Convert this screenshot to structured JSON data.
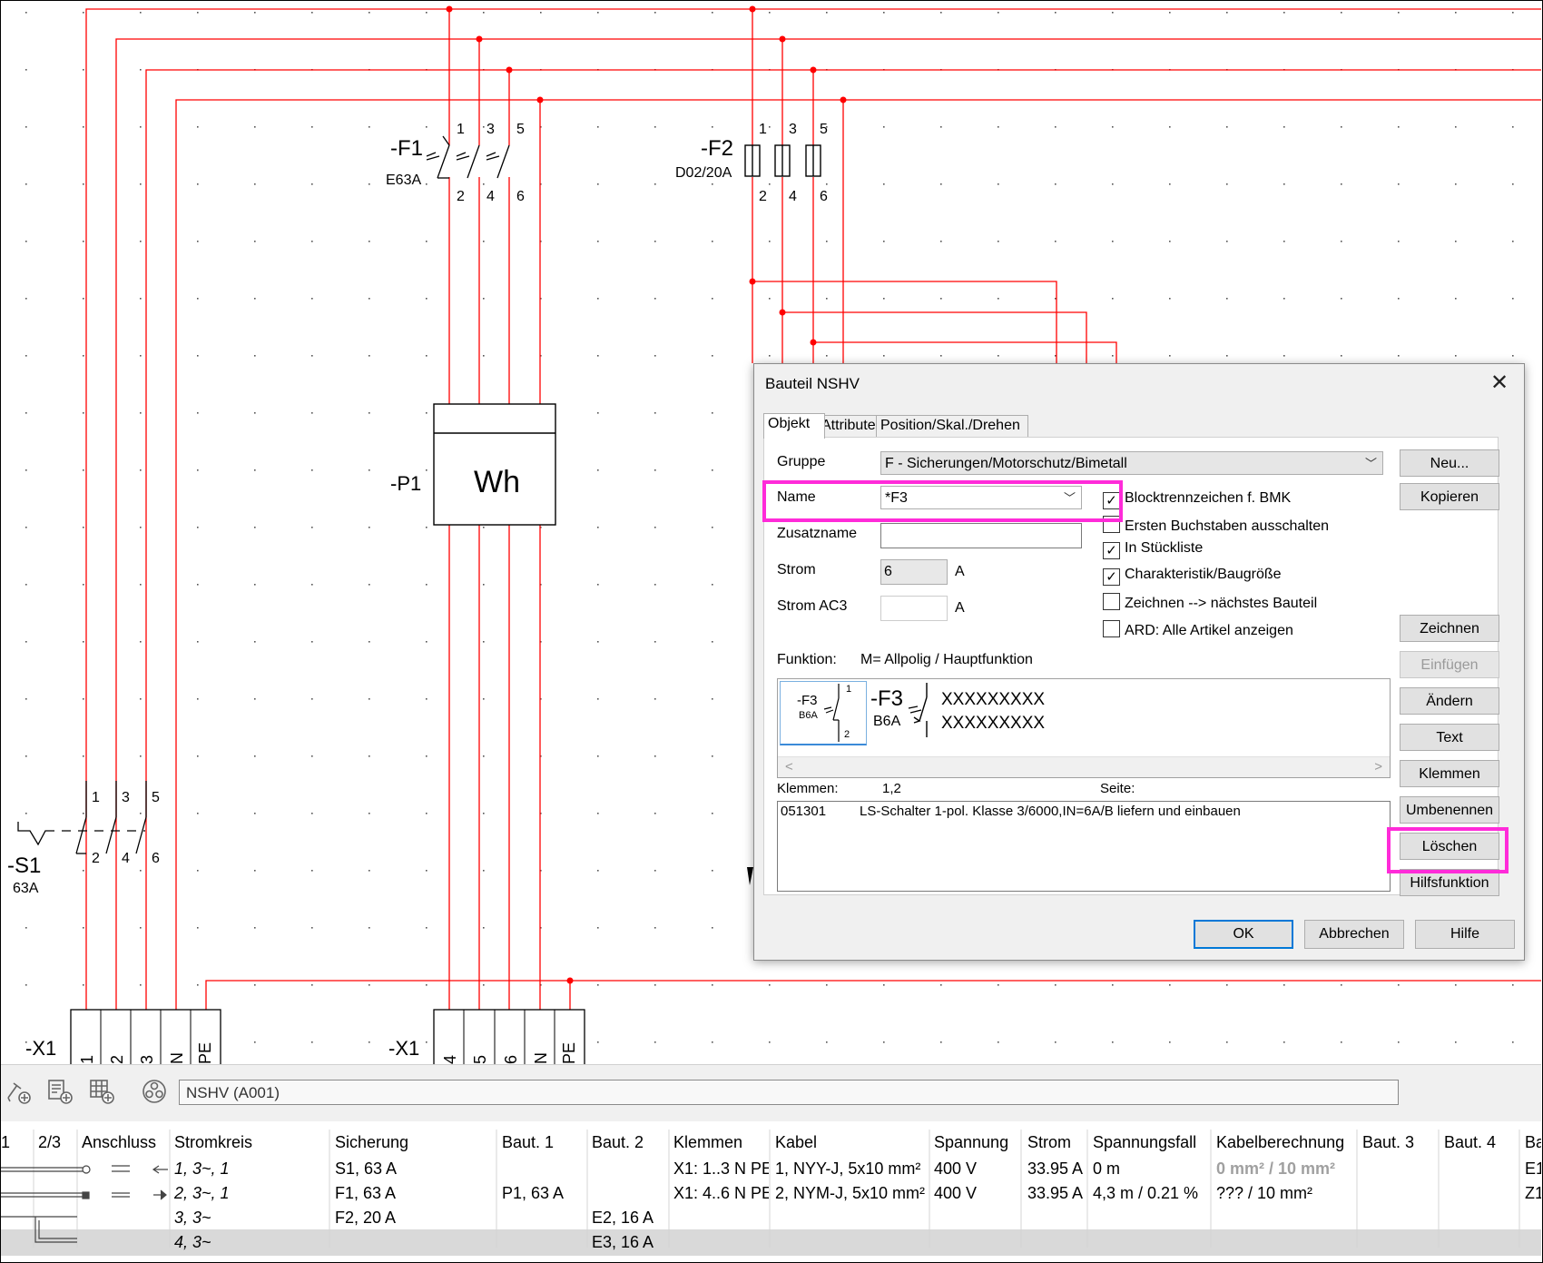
{
  "schematic": {
    "f1": {
      "name": "-F1",
      "rating": "E63A",
      "top_terminals": [
        "1",
        "3",
        "5"
      ],
      "bottom_terminals": [
        "2",
        "4",
        "6"
      ]
    },
    "f2": {
      "name": "-F2",
      "rating": "D02/20A",
      "top_terminals": [
        "1",
        "3",
        "5"
      ],
      "bottom_terminals": [
        "2",
        "4",
        "6"
      ]
    },
    "p1": {
      "name": "-P1",
      "meter_label": "Wh"
    },
    "s1": {
      "name": "-S1",
      "rating": "63A",
      "top_terminals": [
        "1",
        "3",
        "5"
      ],
      "bottom_terminals": [
        "2",
        "4",
        "6"
      ]
    },
    "x1_left": {
      "name": "-X1",
      "terminals": [
        "1",
        "2",
        "3",
        "N",
        "PE"
      ]
    },
    "x1_right": {
      "name": "-X1",
      "terminals": [
        "4",
        "5",
        "6",
        "N",
        "PE"
      ]
    },
    "wire_color": "#ff0000"
  },
  "dialog": {
    "title": "Bauteil NSHV",
    "close_icon": "close-icon",
    "tabs": [
      "Objekt",
      "Attribute",
      "Position/Skal./Drehen"
    ],
    "active_tab": "Objekt",
    "gruppe_label": "Gruppe",
    "gruppe_value": "F - Sicherungen/Motorschutz/Bimetall",
    "name_label": "Name",
    "name_value": "*F3",
    "zusatzname_label": "Zusatzname",
    "zusatzname_value": "",
    "strom_label": "Strom",
    "strom_value": "6",
    "strom_unit": "A",
    "strom_ac3_label": "Strom AC3",
    "strom_ac3_value": "",
    "strom_ac3_unit": "A",
    "checkboxes": [
      {
        "label": "Blocktrennzeichen f. BMK",
        "checked": true
      },
      {
        "label": "Ersten Buchstaben ausschalten",
        "checked": false
      },
      {
        "label": "In Stückliste",
        "checked": true
      },
      {
        "label": "Charakteristik/Baugröße",
        "checked": true
      },
      {
        "label": "Zeichnen --> nächstes Bauteil",
        "checked": false
      },
      {
        "label": "ARD: Alle Artikel anzeigen",
        "checked": false
      }
    ],
    "funktion_label": "Funktion:",
    "funktion_value": "M= Allpolig / Hauptfunktion",
    "preview": {
      "small_name": "-F3",
      "small_rating": "B6A",
      "small_t1": "1",
      "small_t2": "2",
      "big_name": "-F3",
      "big_rating": "B6A",
      "text1": "XXXXXXXXX",
      "text2": "XXXXXXXXX"
    },
    "klemmen_label": "Klemmen:",
    "klemmen_value": "1,2",
    "seite_label": "Seite:",
    "articles": [
      {
        "number": "051301",
        "description": "LS-Schalter 1-pol. Klasse 3/6000,IN=6A/B liefern und einbauen"
      }
    ],
    "buttons": {
      "neu": "Neu...",
      "kopieren": "Kopieren",
      "zeichnen": "Zeichnen",
      "einfuegen": "Einfügen",
      "aendern": "Ändern",
      "text": "Text",
      "klemmen": "Klemmen",
      "umbenennen": "Umbenennen",
      "loeschen": "Löschen",
      "hilfsfunktion": "Hilfsfunktion",
      "ok": "OK",
      "abbrechen": "Abbrechen",
      "hilfe": "Hilfe"
    },
    "highlight_color": "#ff2bd9"
  },
  "bottom": {
    "toolbar_icons": [
      "add-component-icon",
      "add-list-icon",
      "add-table-icon",
      "components-icon"
    ],
    "path": "NSHV (A001)",
    "columns": [
      "1",
      "2/3",
      "Anschluss",
      "Stromkreis",
      "Sicherung",
      "Baut. 1",
      "Baut. 2",
      "Klemmen",
      "Kabel",
      "Spannung",
      "Strom",
      "Spannungsfall",
      "Kabelberechnung",
      "Baut. 3",
      "Baut. 4",
      "Ba"
    ],
    "rows": [
      {
        "stromkreis": "1, 3~, 1",
        "sicherung": "S1, 63 A",
        "baut1": "",
        "baut2": "",
        "klemmen": "X1: 1..3 N PE",
        "kabel": "1, NYY-J, 5x10 mm²",
        "spannung": "400 V",
        "strom": "33.95 A",
        "spannungsfall": "0 m",
        "kabelberechnung": "0 mm² / 10 mm²",
        "last": "E1"
      },
      {
        "stromkreis": "2, 3~, 1",
        "sicherung": "F1, 63 A",
        "baut1": "P1, 63 A",
        "baut2": "",
        "klemmen": "X1: 4..6 N PE",
        "kabel": "2, NYM-J, 5x10 mm²",
        "spannung": "400 V",
        "strom": "33.95 A",
        "spannungsfall": "4,3 m / 0.21 %",
        "kabelberechnung": "??? / 10 mm²",
        "last": "Z1"
      },
      {
        "stromkreis": "3, 3~",
        "sicherung": "F2, 20 A",
        "baut1": "",
        "baut2": "E2, 16 A",
        "klemmen": "",
        "kabel": "",
        "spannung": "",
        "strom": "",
        "spannungsfall": "",
        "kabelberechnung": "",
        "last": ""
      },
      {
        "stromkreis": "4, 3~",
        "sicherung": "",
        "baut1": "",
        "baut2": "E3, 16 A",
        "klemmen": "",
        "kabel": "",
        "spannung": "",
        "strom": "",
        "spannungsfall": "",
        "kabelberechnung": "",
        "last": ""
      }
    ],
    "selected_row": 3
  }
}
